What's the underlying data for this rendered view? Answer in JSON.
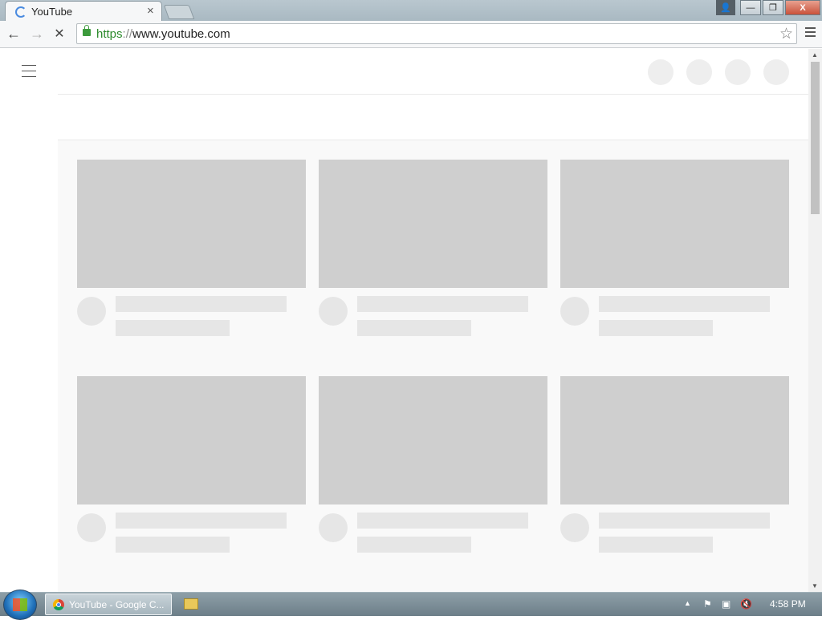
{
  "browser": {
    "tab_title": "YouTube",
    "tab_close": "×",
    "url_scheme": "https",
    "url_sep": "://",
    "url_host": "www.youtube.com",
    "back": "←",
    "forward": "→",
    "stop": "✕",
    "star": "☆"
  },
  "window": {
    "user_icon": "👤",
    "minimize": "—",
    "maximize": "❐",
    "close": "X"
  },
  "page": {
    "state": "loading-skeleton",
    "header_icon_placeholders": 4,
    "video_card_placeholders": 6
  },
  "scroll": {
    "up": "▲",
    "down": "▼"
  },
  "taskbar": {
    "chrome_task_label": "YouTube - Google C...",
    "tray_arrow": "▲",
    "tray_flag": "⚑",
    "tray_network": "▣",
    "tray_volume": "🔇",
    "clock": "4:58 PM"
  },
  "colors": {
    "placeholder_thumb": "#cfcfcf",
    "placeholder_line": "#e6e6e6",
    "feed_background": "#f9f9f9",
    "secure_green": "#2b8a2b"
  }
}
